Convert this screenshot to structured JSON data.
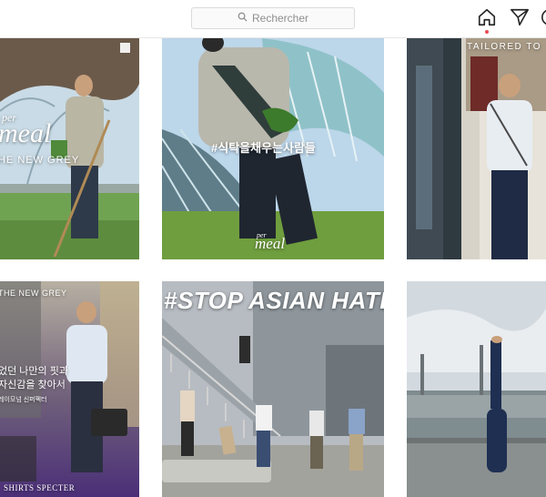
{
  "header": {
    "search_placeholder": "Rechercher",
    "icons": [
      "search-icon",
      "home-icon",
      "send-icon",
      "profile-icon"
    ],
    "notification_color": "#ed4956"
  },
  "posts": [
    {
      "index": 1,
      "overlay_brand": "per",
      "overlay_title": "meal",
      "overlay_sub": "HE NEW GREY",
      "badge_icon": "multi-photo-icon"
    },
    {
      "index": 2,
      "overlay_hashtag": "#식탁을채우는사람들",
      "overlay_brand": "per",
      "overlay_title": "meal"
    },
    {
      "index": 3,
      "overlay_top": "TAILORED TO"
    },
    {
      "index": 4,
      "overlay_top": "THE NEW GREY",
      "overlay_line1": "었던 나만의 핏과",
      "overlay_line2": "자신감을 찾아서",
      "overlay_line3": "레이모넘 신퍼펙터",
      "overlay_brand_bottom": "SHIRTS SPECTER"
    },
    {
      "index": 5,
      "overlay_headline": "#STOP ASIAN HATE"
    },
    {
      "index": 6
    }
  ]
}
